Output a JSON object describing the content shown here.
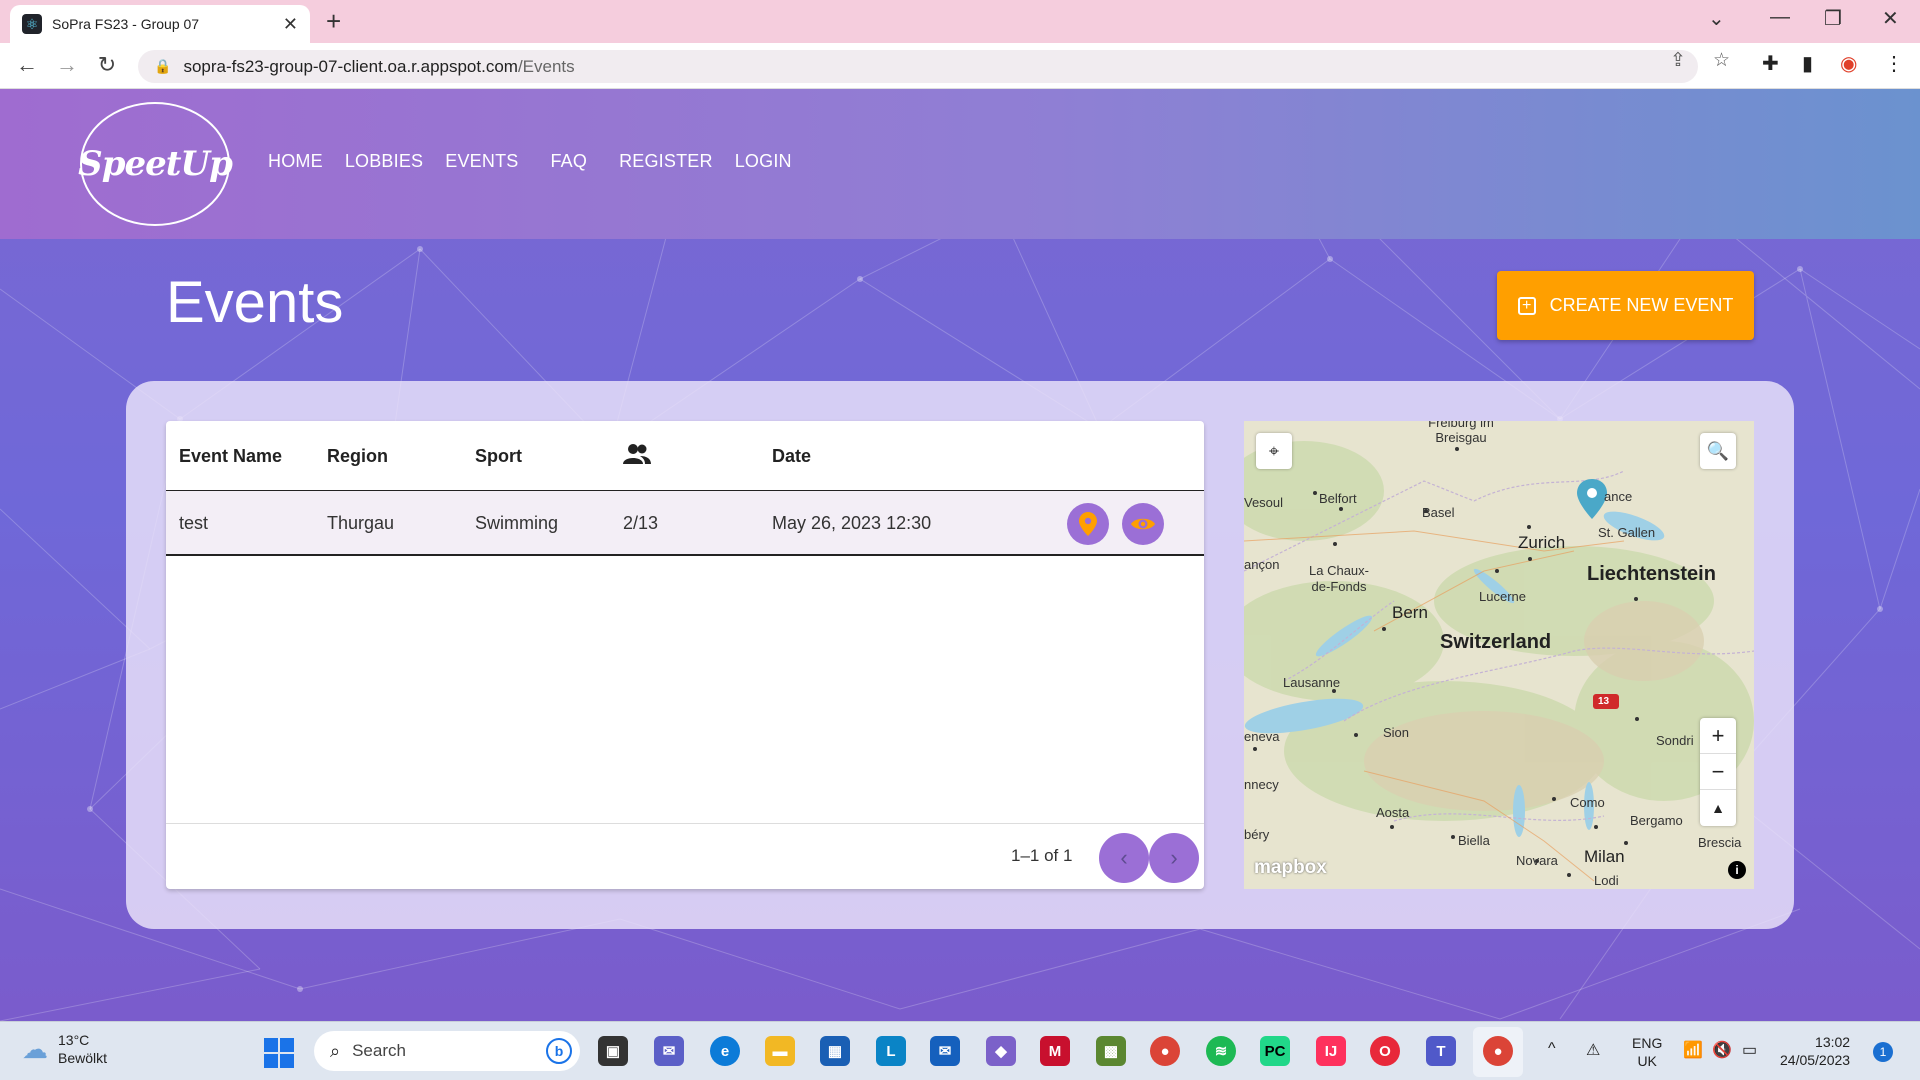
{
  "browser": {
    "tab_title": "SoPra FS23 - Group 07",
    "url_host": "sopra-fs23-group-07-client.oa.r.appspot.com",
    "url_path": "/Events"
  },
  "header": {
    "logo_text": "SpeetUp",
    "nav": [
      "HOME",
      "LOBBIES",
      "EVENTS",
      "FAQ",
      "REGISTER",
      "LOGIN"
    ]
  },
  "page": {
    "title": "Events",
    "create_button": "CREATE NEW EVENT"
  },
  "table": {
    "columns": [
      "Event Name",
      "Region",
      "Sport",
      "participants-icon",
      "Date"
    ],
    "rows": [
      {
        "name": "test",
        "region": "Thurgau",
        "sport": "Swimming",
        "participants": "2/13",
        "date": "May 26, 2023 12:30"
      }
    ],
    "pagination": "1–1 of 1"
  },
  "map": {
    "labels": {
      "freiburg": "Freiburg im Breisgau",
      "vesoul": "Vesoul",
      "belfort": "Belfort",
      "basel": "Basel",
      "konstanz": "ance",
      "stgallen": "St. Gallen",
      "zurich": "Zurich",
      "besancon": "ançon",
      "chauxdefonds": "La Chaux-de-Fonds",
      "liechtenstein": "Liechtenstein",
      "lucerne": "Lucerne",
      "bern": "Bern",
      "switzerland": "Switzerland",
      "lausanne": "Lausanne",
      "road": "13",
      "geneva": "eneva",
      "sion": "Sion",
      "sondrio": "Sondri",
      "annecy": "nnecy",
      "como": "Como",
      "aosta": "Aosta",
      "bergamo": "Bergamo",
      "chambery": "béry",
      "biella": "Biella",
      "brescia": "Brescia",
      "novara": "Novara",
      "milan": "Milan",
      "lodi": "Lodi"
    },
    "attribution": "mapbox"
  },
  "taskbar": {
    "temperature": "13°C",
    "weather": "Bewölkt",
    "search_placeholder": "Search",
    "language": "ENG",
    "region": "UK",
    "time": "13:02",
    "date": "24/05/2023",
    "notification_count": "1"
  },
  "colors": {
    "accent_orange": "#ff9f00",
    "action_purple": "#9b6fd6",
    "pin_blue": "#4aa8c8"
  }
}
